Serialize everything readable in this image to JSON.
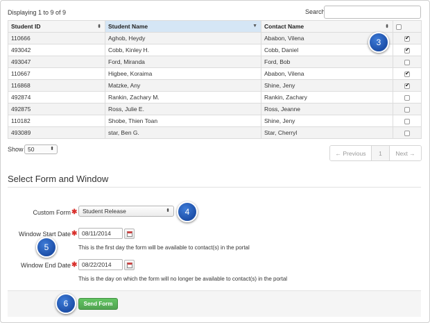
{
  "header": {
    "displaying": "Displaying 1 to 9 of 9",
    "search_label": "Search",
    "search_value": ""
  },
  "table": {
    "columns": [
      "Student ID",
      "Student Name",
      "Contact Name"
    ],
    "rows": [
      {
        "id": "110666",
        "student": "Aghob, Heydy",
        "contact": "Ababon, Vilena",
        "checked": true
      },
      {
        "id": "493042",
        "student": "Cobb, Kinley H.",
        "contact": "Cobb, Daniel",
        "checked": true
      },
      {
        "id": "493047",
        "student": "Ford, Miranda",
        "contact": "Ford, Bob",
        "checked": false
      },
      {
        "id": "110667",
        "student": "Higbee, Koraima",
        "contact": "Ababon, Vilena",
        "checked": true
      },
      {
        "id": "116868",
        "student": "Matzke, Any",
        "contact": "Shine, Jeny",
        "checked": true
      },
      {
        "id": "492874",
        "student": "Rankin, Zachary M.",
        "contact": "Rankin, Zachary",
        "checked": false
      },
      {
        "id": "492875",
        "student": "Ross, Julie E.",
        "contact": "Ross, Jeanne",
        "checked": false
      },
      {
        "id": "110182",
        "student": "Shobe, Thien Toan",
        "contact": "Shine, Jeny",
        "checked": false
      },
      {
        "id": "493089",
        "student": "star, Ben G.",
        "contact": "Star, Cherryl",
        "checked": false
      }
    ]
  },
  "paging": {
    "show_label": "Show",
    "page_size": "50",
    "prev_label": "← Previous",
    "page_number": "1",
    "next_label": "Next →"
  },
  "form": {
    "section_title": "Select Form and Window",
    "custom_form_label": "Custom Form",
    "custom_form_value": "Student Release",
    "start_label": "Window Start Date",
    "start_value": "08/11/2014",
    "start_help": "This is the first day the form will be available to contact(s) in the portal",
    "end_label": "Window End Date",
    "end_value": "08/22/2014",
    "end_help": "This is the day on which the form will no longer be available to contact(s) in the portal",
    "submit_label": "Send Form"
  },
  "callouts": [
    "3",
    "4",
    "5",
    "6"
  ],
  "colors": {
    "accent_blue": "#1d4fa8",
    "button_green": "#51a351",
    "required_red": "#d9302c",
    "sorted_header": "#d5e6f5"
  }
}
